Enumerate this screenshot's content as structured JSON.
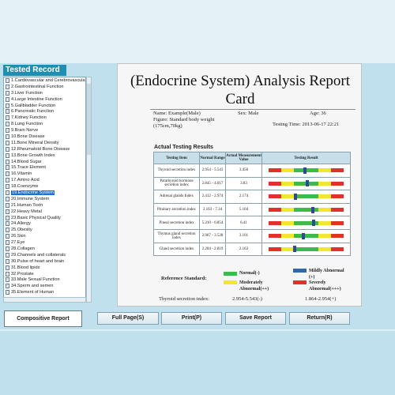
{
  "sidebar": {
    "title": "Tested Record",
    "items": [
      "1.Cardiovascular and Cerebrovascular",
      "2.Gastrointestinal Function",
      "3.Liver Function",
      "4.Large Intestine Function",
      "5.Gallbladder Function",
      "6.Pancreatic Function",
      "7.Kidney Function",
      "8.Lung Function",
      "9.Brain Nerve",
      "10.Bone Disease",
      "11.Bone Mineral Density",
      "12.Rheumatoid Bone Disease",
      "13.Bone Growth Index",
      "14.Blood Sugar",
      "15.Trace Element",
      "16.Vitamin",
      "17.Amino Acid",
      "18.Coenzyme",
      "19.Endocrine System",
      "20.Immune System",
      "21.Human Toxin",
      "22.Heavy Metal",
      "23.Basic Physical Quality",
      "24.Allergy",
      "25.Obesity",
      "26.Skin",
      "27.Eye",
      "28.Collagen",
      "29.Channels and collaterals",
      "30.Pulse of heart and brain",
      "31.Blood lipids",
      "32.Prostate",
      "33.Male Sexual Function",
      "34.Sperm and semen",
      "35.Element of Human"
    ],
    "selected_index": 18
  },
  "report": {
    "title": "(Endocrine System) Analysis Report Card",
    "name": "Name: Example(Male)",
    "sex": "Sex: Male",
    "age": "Age: 36",
    "figure": "Figure: Standard body weight (175cm,70kg)",
    "testing_time": "Testing Time: 2013-06-17 22:21",
    "section_title": "Actual Testing Results",
    "columns": [
      "Testing Item",
      "Normal Range",
      "Actual Measurement Value",
      "Testing Result"
    ],
    "rows": [
      {
        "item": "Thyroid secretion index",
        "range": "2.954 - 5.543",
        "value": "3.456",
        "result_level": 0.46
      },
      {
        "item": "Parathyroid hormone secretion index",
        "range": "2.845 - 4.017",
        "value": "3.83",
        "result_level": 0.49
      },
      {
        "item": "Adrenal glands Index",
        "range": "2.412 - 2.974",
        "value": "2.174",
        "result_level": 0.34
      },
      {
        "item": "Pituitary secretion index",
        "range": "2.163 - 7.34",
        "value": "5.104",
        "result_level": 0.57
      },
      {
        "item": "Pineal secretion index",
        "range": "5.210 - 6.854",
        "value": "6.41",
        "result_level": 0.58
      },
      {
        "item": "Thymus gland secretion index",
        "range": "2.967 - 3.528",
        "value": "3.101",
        "result_level": 0.44
      },
      {
        "item": "Gland secretion index",
        "range": "2.204 - 2.819",
        "value": "2.163",
        "result_level": 0.33
      }
    ],
    "reference_label": "Reference Standard:",
    "legend": [
      {
        "label": "Normal(-)",
        "color": "#3fb94a"
      },
      {
        "label": "Mildly Abnormal (+)",
        "color": "#2f69a8"
      },
      {
        "label": "Moderately Abnormal(++)",
        "color": "#f2e62e"
      },
      {
        "label": "Severely Abnormal(+++)",
        "color": "#e0322a"
      }
    ],
    "reference_row": {
      "label": "Thyroid secretion index:",
      "normal": "2.954-5.543(-)",
      "mild": "1.864-2.954(+)"
    }
  },
  "buttons": {
    "compositive": "Compositive Report",
    "full_page": "Full Page(S)",
    "print": "Print(P)",
    "save": "Save Report",
    "return": "Return(R)"
  },
  "colors": {
    "bar_red": "#e0322a",
    "bar_yellow": "#f2e62e",
    "bar_green": "#3fb94a",
    "marker": "#2d4a94"
  }
}
